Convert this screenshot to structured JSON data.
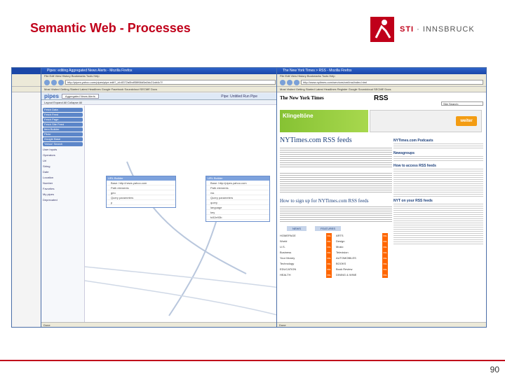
{
  "slide": {
    "title": "Semantic Web - Processes",
    "logo_brand": "STI",
    "logo_city": "INNSBRUCK",
    "page_number": "90"
  },
  "pipes_window": {
    "title": "Pipes: editing Aggregated News Alerts - Mozilla Firefox",
    "menu": "File  Edit  View  History  Bookmarks  Tools  Help",
    "url": "http://pipes.yahoo.com/pipes/pipe.edit?_id=8372a0bdf38f66d5a0dc21ab4c7f",
    "bookmarks": "Most Visited  Getting Started  Latest Headlines  Google  Facebook  Soundcloud  SECME Docs",
    "app_name": "pipes",
    "tab_label": "Aggregated News Alerts",
    "pipe_status": "Pipe: Untitled   Run Pipe",
    "toolbar": "Layout   Expand All   Collapse All",
    "sources": [
      "Fetch Data",
      "Fetch Feed",
      "Fetch Page",
      "Fetch Site Feed",
      "Item Builder",
      "Flickr",
      "Google Base",
      "Yahoo! Search"
    ],
    "categories": [
      "User inputs",
      "Operators",
      "Url",
      "String",
      "Date",
      "Location",
      "Number",
      "Favorites",
      "My pipes",
      "Deprecated"
    ],
    "module_left_title": "URL Builder",
    "module_left_rows": [
      "Base: http://news.yahoo.com",
      "Path elements",
      "geo",
      "Query parameters",
      "p"
    ],
    "module_right_title": "URL Builder",
    "module_right_rows": [
      "Base: http://pipes.yahoo.com",
      "Path elements",
      "rss",
      "Query parameters",
      "query",
      "language",
      "key",
      "fc52e93b"
    ],
    "status": "Done"
  },
  "nyt_window": {
    "title": "The New York Times > RSS - Mozilla Firefox",
    "menu": "File  Edit  View  History  Bookmarks  Tools  Help",
    "url": "http://www.nytimes.com/services/xml/rss/index.html",
    "bookmarks": "Most Visited  Getting Started  Latest Headlines  Register  Google  Soundcloud  SECME Docs",
    "masthead": "The New York Times",
    "rss_label": "RSS",
    "search_placeholder": "Site Search:",
    "ad_text": "Klingeltöne",
    "ad_button": "weiter",
    "heading": "NYTimes.com RSS feeds",
    "subheading": "How to sign up for NYTimes.com RSS feeds",
    "side_headings": [
      "NYTimes.com Podcasts",
      "Newsgroups",
      "How to access RSS feeds",
      "NYT on your RSS feeds"
    ],
    "feed_tabs": [
      "NEWS",
      "FEATURES"
    ],
    "feed_rows": [
      [
        "HOMEPAGE",
        "ARTS"
      ],
      [
        "World",
        "Design"
      ],
      [
        "U.S.",
        "Music"
      ],
      [
        "Business",
        "Television"
      ],
      [
        "Your Money",
        "AUTOMOBILES"
      ],
      [
        "Technology",
        "BOOKS"
      ],
      [
        "EDUCATION",
        "Book Review"
      ],
      [
        "HEALTH",
        "DINING & WINE"
      ]
    ],
    "status": "Done"
  }
}
